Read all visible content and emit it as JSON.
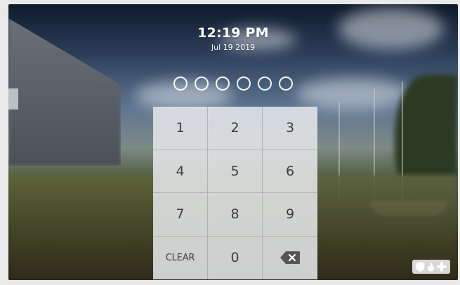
{
  "clock": {
    "time": "12:19 PM",
    "date": "Jul 19 2019"
  },
  "pin": {
    "length": 6,
    "entered": 0
  },
  "keypad": {
    "keys": [
      "1",
      "2",
      "3",
      "4",
      "5",
      "6",
      "7",
      "8",
      "9",
      "CLEAR",
      "0"
    ],
    "backspace_icon": "backspace-icon"
  },
  "status": {
    "icons": [
      "shield-icon",
      "fire-icon",
      "medical-cross-icon"
    ],
    "badge_color": "#d8d8d8"
  },
  "colors": {
    "keypad_text": "#3e3e3e",
    "backspace_fill": "#555555"
  }
}
